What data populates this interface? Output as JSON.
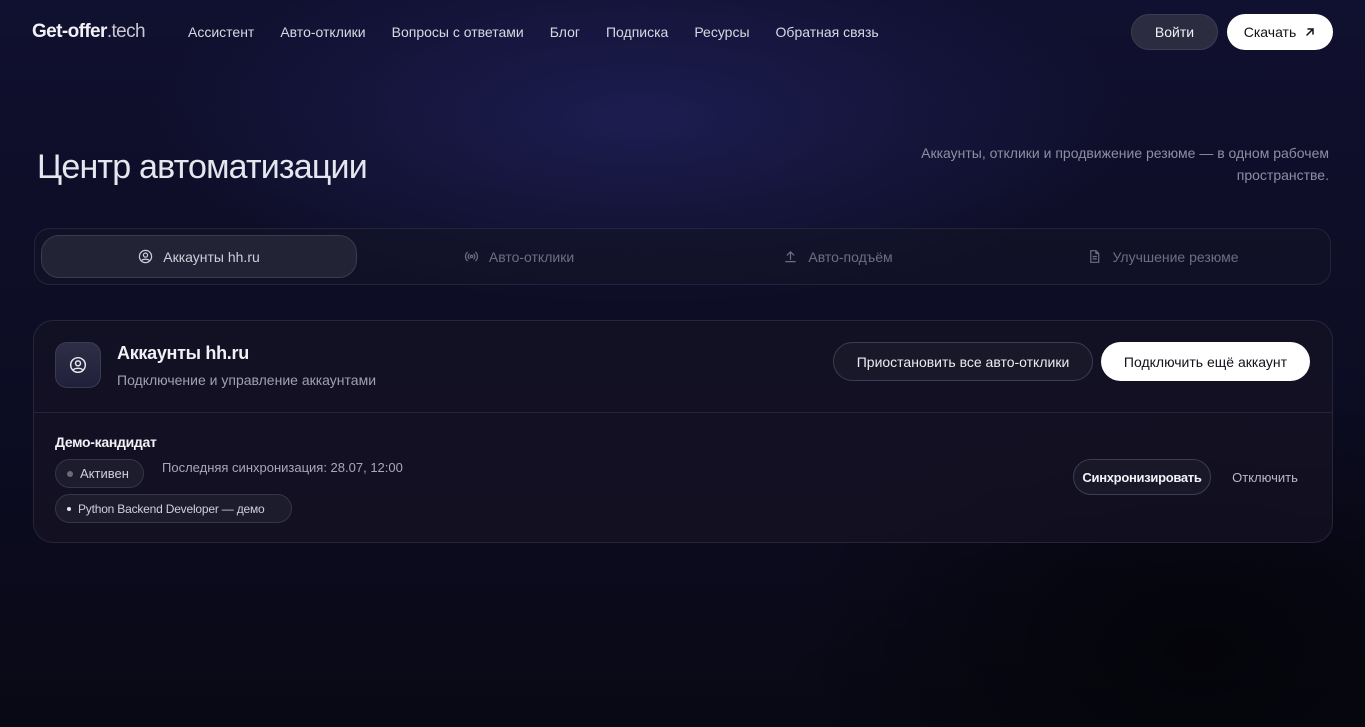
{
  "nav": {
    "logo_main": "Get-offer",
    "logo_tld": ".tech",
    "links": [
      "Ассистент",
      "Авто-отклики",
      "Вопросы с ответами",
      "Блог",
      "Подписка",
      "Ресурсы",
      "Обратная связь"
    ],
    "login_label": "Войти",
    "download_label": "Скачать",
    "download_icon": "arrow-up-right-icon"
  },
  "hero": {
    "title": "Центр автоматизации",
    "subtitle": "Аккаунты, отклики и продвижение резюме — в одном рабочем пространстве."
  },
  "tabs": [
    {
      "label": "Аккаунты hh.ru",
      "icon": "user-circle-icon",
      "active": true
    },
    {
      "label": "Авто-отклики",
      "icon": "broadcast-icon",
      "active": false
    },
    {
      "label": "Авто-подъём",
      "icon": "upload-icon",
      "active": false
    },
    {
      "label": "Улучшение резюме",
      "icon": "document-icon",
      "active": false
    }
  ],
  "card": {
    "icon": "user-circle-icon",
    "title": "Аккаунты hh.ru",
    "subtitle": "Подключение и управление аккаунтами",
    "pause_all_label": "Приостановить все авто-отклики",
    "connect_label": "Подключить ещё аккаунт",
    "account": {
      "name": "Демо-кандидат",
      "status": "Активен",
      "last_sync": "Последняя синхронизация: 28.07, 12:00",
      "resume": "Python Backend Developer — демо",
      "sync_label": "Синхронизировать",
      "disconnect_label": "Отключить"
    }
  }
}
